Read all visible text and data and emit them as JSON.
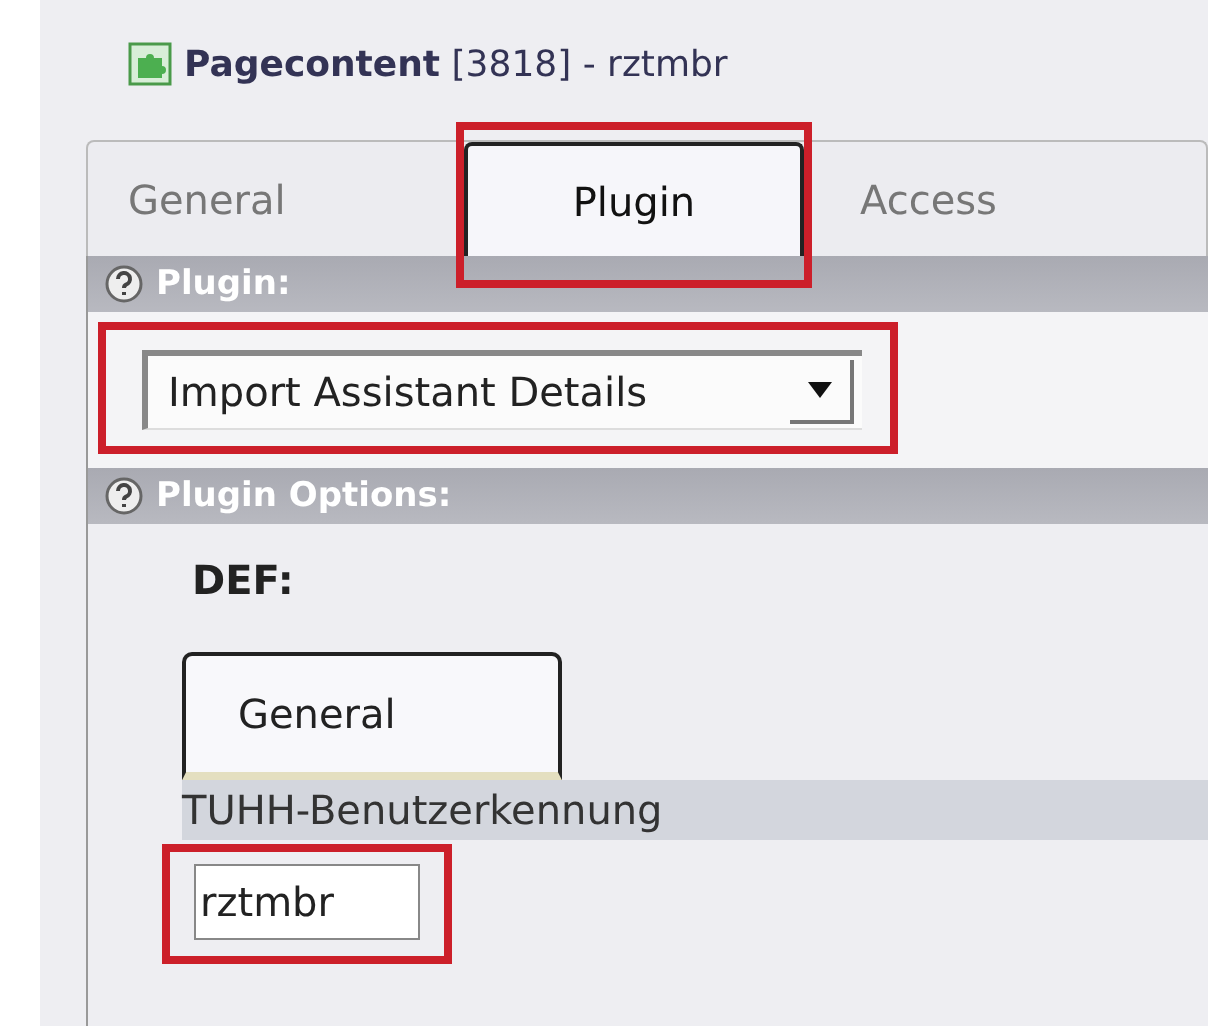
{
  "header": {
    "title_bold": "Pagecontent",
    "title_rest": "[3818] - rztmbr"
  },
  "tabs": [
    {
      "label": "General",
      "selected": false,
      "highlighted": false
    },
    {
      "label": "Plugin",
      "selected": true,
      "highlighted": true
    },
    {
      "label": "Access",
      "selected": false,
      "highlighted": false
    }
  ],
  "plugin_section": {
    "heading": "Plugin:",
    "select": {
      "value": "Import Assistant Details",
      "highlighted": true
    }
  },
  "options_section": {
    "heading": "Plugin Options:",
    "def_label": "DEF:",
    "inner_tabs": [
      {
        "label": "General",
        "selected": true
      }
    ],
    "field": {
      "label": "TUHH-Benutzerkennung",
      "value": "rztmbr",
      "highlighted": true
    }
  }
}
